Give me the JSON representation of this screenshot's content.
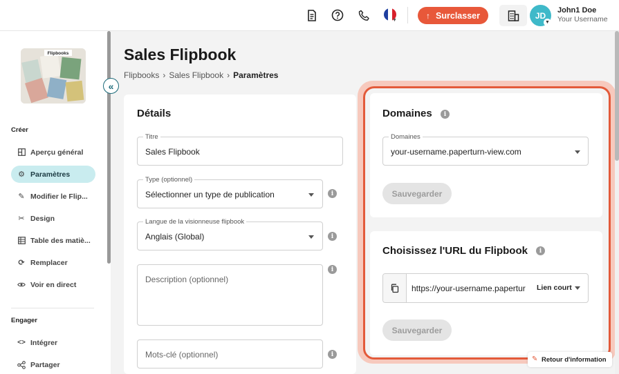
{
  "topbar": {
    "upgrade_label": "Surclasser",
    "avatar_initials": "JD",
    "user_name": "John1 Doe",
    "user_subtitle": "Your Username",
    "icons": [
      "document-icon",
      "help-icon",
      "phone-icon",
      "flag-fr-icon",
      "organization-icon"
    ]
  },
  "sidebar": {
    "section_create": "Créer",
    "section_engage": "Engager",
    "items": [
      {
        "label": "Aperçu général",
        "icon": "overview-icon",
        "active": false
      },
      {
        "label": "Paramètres",
        "icon": "gear-icon",
        "active": true
      },
      {
        "label": "Modifier le Flip...",
        "icon": "pencil-icon",
        "active": false
      },
      {
        "label": "Design",
        "icon": "design-icon",
        "active": false
      },
      {
        "label": "Table des matiè...",
        "icon": "table-icon",
        "active": false
      },
      {
        "label": "Remplacer",
        "icon": "replace-icon",
        "active": false
      },
      {
        "label": "Voir en direct",
        "icon": "eye-icon",
        "active": false
      }
    ],
    "engage_items": [
      {
        "label": "Intégrer",
        "icon": "code-icon"
      },
      {
        "label": "Partager",
        "icon": "share-icon"
      }
    ]
  },
  "page": {
    "title": "Sales Flipbook",
    "breadcrumb": [
      "Flipbooks",
      "Sales Flipbook",
      "Paramètres"
    ]
  },
  "details": {
    "title": "Détails",
    "title_field": {
      "label": "Titre",
      "value": "Sales Flipbook"
    },
    "type_field": {
      "label": "Type (optionnel)",
      "value": "Sélectionner un type de publication"
    },
    "language_field": {
      "label": "Langue de la visionneuse flipbook",
      "value": "Anglais (Global)"
    },
    "description_placeholder": "Description (optionnel)",
    "keywords_placeholder": "Mots-clé (optionnel)"
  },
  "domains": {
    "title": "Domaines",
    "field_label": "Domaines",
    "value": "your-username.paperturn-view.com",
    "save_label": "Sauvegarder"
  },
  "url": {
    "title": "Choisissez l'URL du Flipbook",
    "value": "https://your-username.paperturn-",
    "short_link_label": "Lien court",
    "save_label": "Sauvegarder"
  },
  "return_chip": "Retour d'information",
  "colors": {
    "accent": "#e8583a",
    "active_nav": "#c9ecef",
    "avatar": "#3fb9c9"
  }
}
